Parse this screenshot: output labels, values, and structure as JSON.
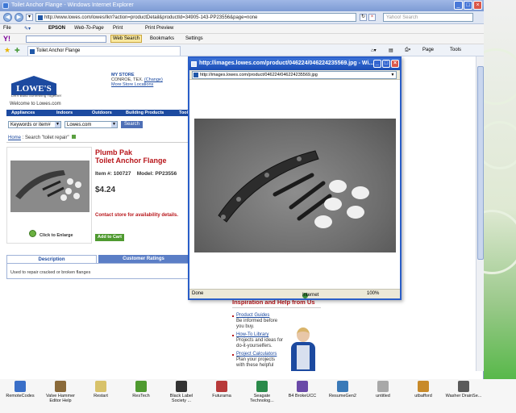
{
  "window": {
    "title": "Toilet Anchor Flange - Windows Internet Explorer",
    "url": "http://www.lowes.com/lowes/lkn?action=productDetail&productId=34905-143-PP23556&page=none",
    "search_placeholder": "Yahoo! Search"
  },
  "menubar": {
    "file": "File",
    "epson": "EPSON",
    "web_to_page": "Web-To-Page",
    "print": "Print",
    "print_preview": "Print Preview"
  },
  "yahoobar": {
    "logo": "Y!",
    "web_search": "Web Search",
    "bookmarks": "Bookmarks",
    "settings": "Settings"
  },
  "favbar": {
    "tab_title": "Toilet Anchor Flange",
    "page_cmd": "Page",
    "tools_cmd": "Tools"
  },
  "page": {
    "logo": "LOWE'S",
    "tagline": "Let's Build Something Together",
    "welcome": "Welcome to Lowes.com",
    "my_store_label": "MY STORE",
    "store_city": "CONROE, TEX.",
    "change": "(Change)",
    "more_store": "More Store Locations",
    "nav": {
      "appliances": "Appliances",
      "indoors": "Indoors",
      "outdoors": "Outdoors",
      "building": "Building Products",
      "tools": "Tools"
    },
    "search": {
      "select1": "Keywords or item#",
      "select2": "Lowes.com",
      "button": "Search"
    },
    "crumb_home": "Home",
    "crumb_search": ": Search \"toilet repair\"",
    "product": {
      "brand": "Plumb Pak",
      "name": "Toilet Anchor Flange",
      "item": "Item #: 100727",
      "model": "Model: PP23556",
      "price": "$4.24",
      "availability": "Contact store for availability details.",
      "add_to_cart": "Add to Cart",
      "enlarge": "Click to Enlarge"
    },
    "tabs": {
      "description": "Description",
      "customer_ratings": "Customer Ratings"
    },
    "description_text": "Used to repair cracked or broken flanges",
    "help": {
      "title": "Inspiration and Help from Us",
      "items": [
        {
          "link": "Product Guides",
          "text": "Be informed before you buy."
        },
        {
          "link": "How-To Library",
          "text": "Projects and ideas for do-it-yourselfers."
        },
        {
          "link": "Project Calculators",
          "text": "Plan your projects with these helpful"
        }
      ]
    }
  },
  "popup": {
    "title": "http://images.lowes.com/product/046224/046224235569.jpg - Wi...",
    "url": "http://images.lowes.com/product/046224/046224235569.jpg",
    "status_done": "Done",
    "status_zone": "Internet",
    "zoom": "100%"
  },
  "taskbar": [
    {
      "label": "RemoteCodes",
      "color": "#3a6fc8"
    },
    {
      "label": "Valve Hammer Editor Help",
      "color": "#8a6a3a"
    },
    {
      "label": "Restart",
      "color": "#d8c26a"
    },
    {
      "label": "ResTech",
      "color": "#4f9a30"
    },
    {
      "label": "Black Label Society ...",
      "color": "#333333"
    },
    {
      "label": "Futurama",
      "color": "#b83a3a"
    },
    {
      "label": "Seagate Technolog...",
      "color": "#2a8a4a"
    },
    {
      "label": "B4 BrokeUCC",
      "color": "#6a4aa8"
    },
    {
      "label": "ResumeGen2",
      "color": "#3a7ab8"
    },
    {
      "label": "untitled",
      "color": "#a8a8a8"
    },
    {
      "label": "utbafford",
      "color": "#c88a2a"
    },
    {
      "label": "Washer DrainSe...",
      "color": "#5a5a5a"
    }
  ]
}
